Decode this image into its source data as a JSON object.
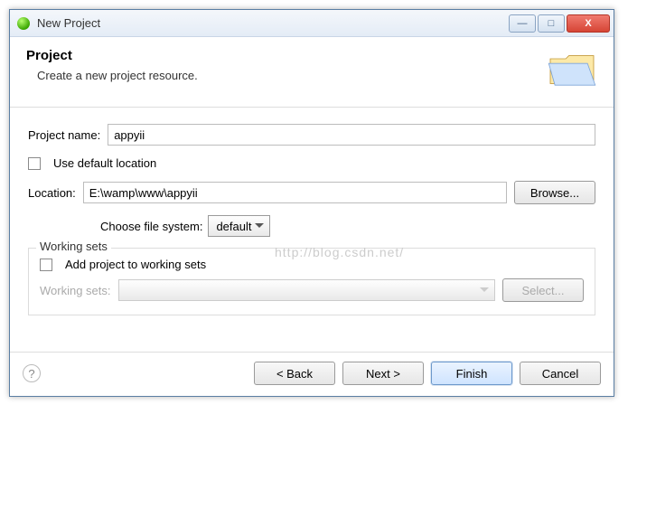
{
  "window": {
    "title": "New Project"
  },
  "header": {
    "title": "Project",
    "subtitle": "Create a new project resource."
  },
  "form": {
    "project_name_label": "Project name:",
    "project_name_value": "appyii",
    "use_default_location_label": "Use default location",
    "location_label": "Location:",
    "location_value": "E:\\wamp\\www\\appyii",
    "browse_label": "Browse...",
    "choose_fs_label": "Choose file system:",
    "fs_value": "default"
  },
  "working_sets": {
    "legend": "Working sets",
    "add_label": "Add project to working sets",
    "label": "Working sets:",
    "select_btn": "Select..."
  },
  "footer": {
    "back": "< Back",
    "next": "Next >",
    "finish": "Finish",
    "cancel": "Cancel"
  },
  "watermark": "http://blog.csdn.net/"
}
